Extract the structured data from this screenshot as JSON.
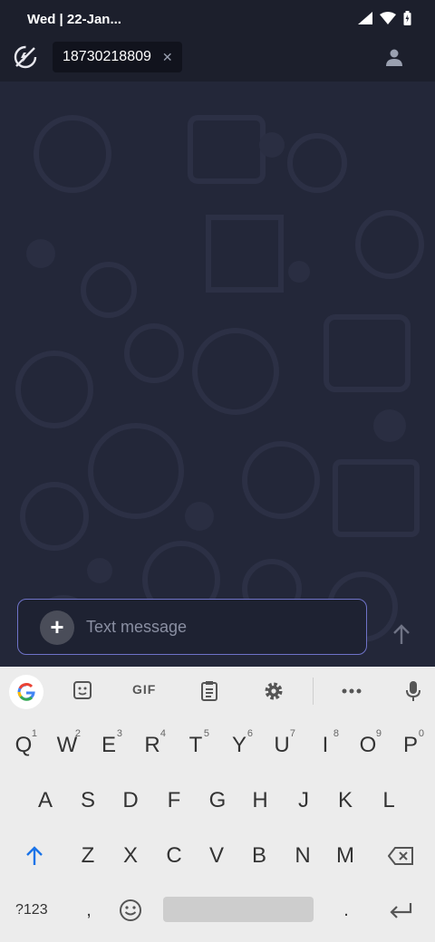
{
  "status": {
    "time": "Wed | 22-Jan..."
  },
  "header": {
    "chip_label": "18730218809",
    "chip_close": "✕"
  },
  "composer": {
    "placeholder": "Text message",
    "attach": "+"
  },
  "keyboard": {
    "toolbar": {
      "gif": "GIF"
    },
    "row1": [
      {
        "k": "Q",
        "h": "1"
      },
      {
        "k": "W",
        "h": "2"
      },
      {
        "k": "E",
        "h": "3"
      },
      {
        "k": "R",
        "h": "4"
      },
      {
        "k": "T",
        "h": "5"
      },
      {
        "k": "Y",
        "h": "6"
      },
      {
        "k": "U",
        "h": "7"
      },
      {
        "k": "I",
        "h": "8"
      },
      {
        "k": "O",
        "h": "9"
      },
      {
        "k": "P",
        "h": "0"
      }
    ],
    "row2": [
      "A",
      "S",
      "D",
      "F",
      "G",
      "H",
      "J",
      "K",
      "L"
    ],
    "row3": [
      "Z",
      "X",
      "C",
      "V",
      "B",
      "N",
      "M"
    ],
    "bottom": {
      "symbols": "?123",
      "comma": ",",
      "period": "."
    }
  }
}
